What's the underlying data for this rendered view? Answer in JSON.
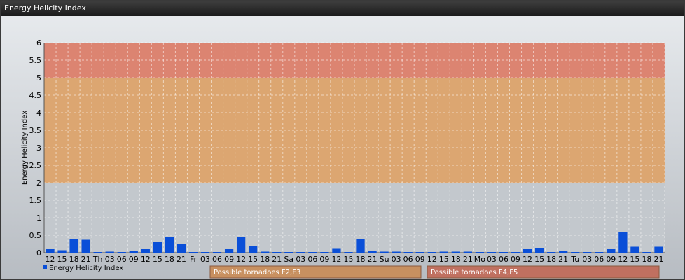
{
  "window": {
    "title": "Energy Helicity Index"
  },
  "chart_data": {
    "type": "bar",
    "ylabel": "Energy Helicity Index",
    "ylim": [
      0,
      6
    ],
    "yticks": [
      0,
      0.5,
      1,
      1.5,
      2,
      2.5,
      3,
      3.5,
      4,
      4.5,
      5,
      5.5,
      6
    ],
    "ytick_labels": [
      "0",
      "0.5",
      "1",
      "1.5",
      "2",
      "2.5",
      "3",
      "3.5",
      "4",
      "4.5",
      "5",
      "5.5",
      "6"
    ],
    "grid": true,
    "bands": [
      {
        "from": 2,
        "to": 5,
        "color": "#e0a060"
      },
      {
        "from": 5,
        "to": 6,
        "color": "#e07860"
      }
    ],
    "categories": [
      "12",
      "15",
      "18",
      "21",
      "Th",
      "03",
      "06",
      "09",
      "12",
      "15",
      "18",
      "21",
      "Fr",
      "03",
      "06",
      "09",
      "12",
      "15",
      "18",
      "21",
      "Sa",
      "03",
      "06",
      "09",
      "12",
      "15",
      "18",
      "21",
      "Su",
      "03",
      "06",
      "09",
      "12",
      "15",
      "18",
      "21",
      "Mo",
      "03",
      "06",
      "09",
      "12",
      "15",
      "18",
      "21",
      "Tu",
      "03",
      "06",
      "09",
      "12",
      "15",
      "18",
      "21"
    ],
    "tick_every": 1,
    "series": [
      {
        "name": "Energy Helicity Index",
        "color": "#0a4fd8",
        "values": [
          0.1,
          0.07,
          0.38,
          0.37,
          0.02,
          0.03,
          0.02,
          0.04,
          0.1,
          0.3,
          0.45,
          0.24,
          0.02,
          0.02,
          0.02,
          0.1,
          0.45,
          0.18,
          0.03,
          0.02,
          0.02,
          0.02,
          0.02,
          0.02,
          0.11,
          0.02,
          0.4,
          0.06,
          0.03,
          0.03,
          0.02,
          0.02,
          0.02,
          0.03,
          0.03,
          0.03,
          0.02,
          0.02,
          0.02,
          0.02,
          0.1,
          0.12,
          0.02,
          0.06,
          0.02,
          0.02,
          0.02,
          0.1,
          0.6,
          0.17,
          0.02,
          0.17
        ]
      }
    ],
    "legend_position": "bottom-left",
    "annotations": [
      {
        "text": "Possible tornadoes F2,F3",
        "color": "#c89060"
      },
      {
        "text": "Possible tornadoes F4,F5",
        "color": "#c07060"
      }
    ]
  }
}
